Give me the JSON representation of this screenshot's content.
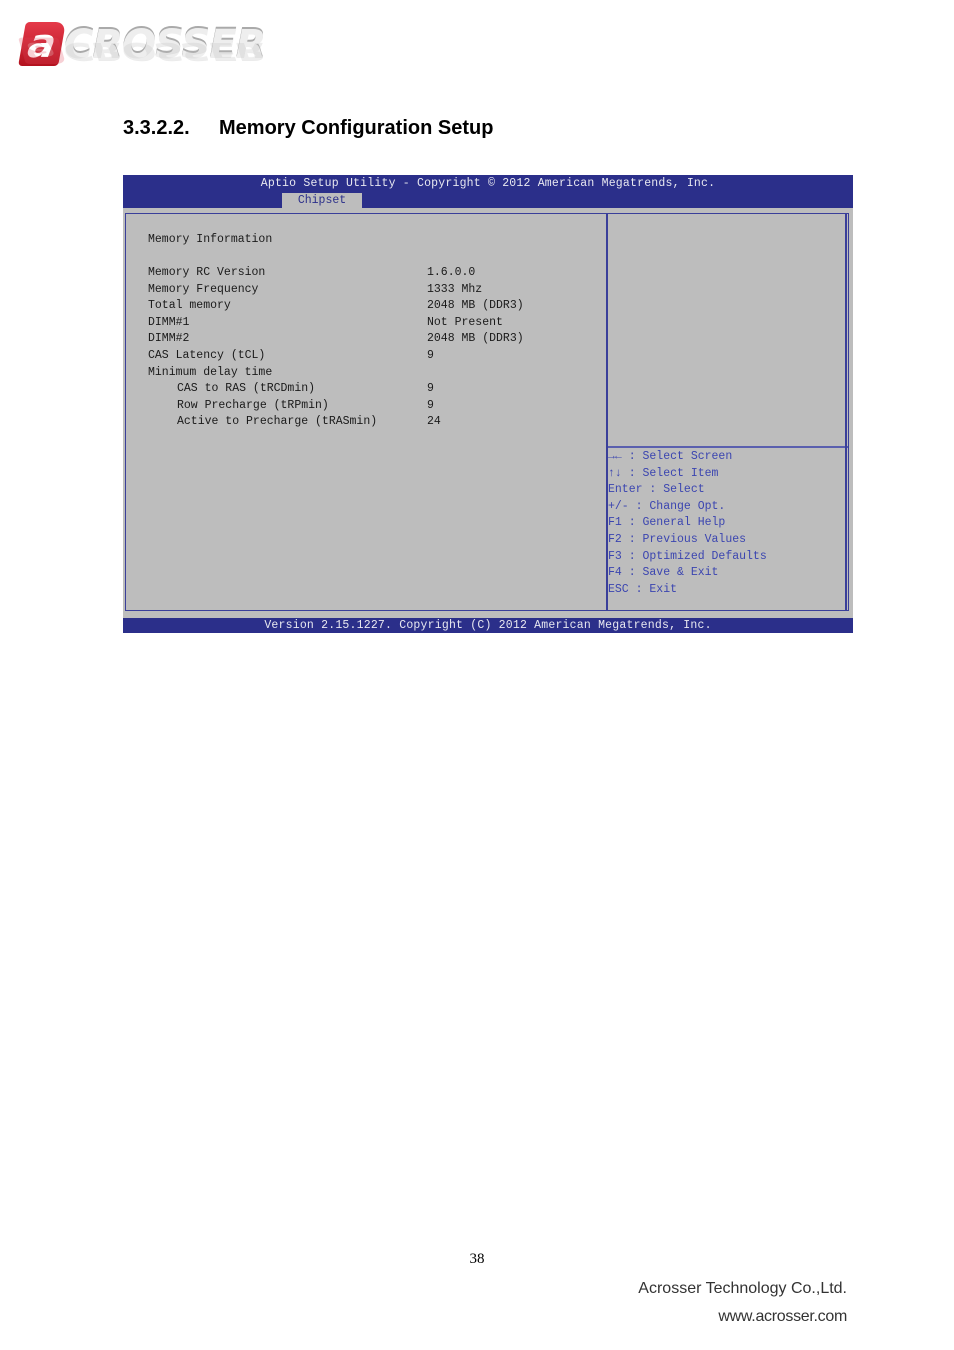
{
  "logo": {
    "mark": "a",
    "text": "CROSSER"
  },
  "section": {
    "number": "3.3.2.2.",
    "title": "Memory Configuration Setup"
  },
  "bios": {
    "title": "Aptio Setup Utility - Copyright © 2012 American Megatrends, Inc.",
    "active_tab": "Chipset",
    "footer": "Version 2.15.1227. Copyright (C) 2012 American Megatrends, Inc.",
    "colors": {
      "header_bg": "#2b2f8a",
      "panel_bg": "#bdbdbd",
      "help_text": "#3b45b0"
    },
    "info_heading": "Memory Information",
    "rows": [
      {
        "label": "Memory RC Version",
        "value": "1.6.0.0",
        "indent": false
      },
      {
        "label": "Memory Frequency",
        "value": "1333 Mhz",
        "indent": false
      },
      {
        "label": "Total memory",
        "value": "2048 MB (DDR3)",
        "indent": false
      },
      {
        "label": "DIMM#1",
        "value": "Not Present",
        "indent": false
      },
      {
        "label": "DIMM#2",
        "value": "2048 MB (DDR3)",
        "indent": false
      },
      {
        "label": "CAS Latency (tCL)",
        "value": "9",
        "indent": false
      },
      {
        "label": "Minimum delay time",
        "value": "",
        "indent": false
      },
      {
        "label": "CAS to RAS (tRCDmin)",
        "value": "9",
        "indent": true
      },
      {
        "label": "Row Precharge (tRPmin)",
        "value": "9",
        "indent": true
      },
      {
        "label": "Active to Precharge (tRASmin)",
        "value": "24",
        "indent": true
      }
    ],
    "help": [
      "→← : Select Screen",
      "↑↓ : Select Item",
      "Enter : Select",
      "+/- : Change Opt.",
      "F1 : General Help",
      "F2 : Previous Values",
      "F3 : Optimized Defaults",
      "F4 : Save & Exit",
      "ESC : Exit"
    ]
  },
  "page": {
    "number": "38",
    "company": "Acrosser Technology Co.,Ltd.",
    "website": "www.acrosser.com"
  }
}
